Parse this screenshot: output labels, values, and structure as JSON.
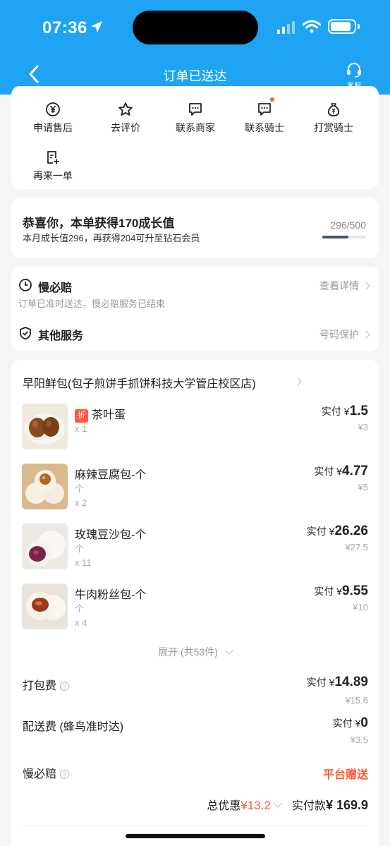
{
  "status_bar": {
    "time": "07:36"
  },
  "nav": {
    "title": "订单已送达",
    "customer_service": "客服"
  },
  "actions": [
    {
      "label": "申请售后",
      "icon": "refund-yen-icon"
    },
    {
      "label": "去评价",
      "icon": "star-icon"
    },
    {
      "label": "联系商家",
      "icon": "chat-icon"
    },
    {
      "label": "联系骑士",
      "icon": "chat-icon",
      "badge": true
    },
    {
      "label": "打赏骑士",
      "icon": "money-bag-icon"
    },
    {
      "label": "再来一单",
      "icon": "add-order-icon"
    }
  ],
  "growth": {
    "title": "恭喜你，本单获得170成长值",
    "subtitle": "本月成长值296，再获得204可升至钻石会员",
    "count": "296/500",
    "progress": 0.592
  },
  "services": {
    "guarantee": {
      "title": "慢必赔",
      "subtitle": "订单已准时送达，慢必赔服务已结束",
      "link": "查看详情"
    },
    "other": {
      "title": "其他服务",
      "link": "号码保护"
    }
  },
  "order": {
    "shop": "早阳鲜包(包子煎饼手抓饼科技大学管庄校区店)",
    "paid_prefix": "实付 ¥",
    "items": [
      {
        "name": "茶叶蛋",
        "tag": "折",
        "unit": "",
        "qty": "x 1",
        "paid": "1.5",
        "original": "¥3"
      },
      {
        "name": "麻辣豆腐包-个",
        "tag": "",
        "unit": "个",
        "qty": "x 2",
        "paid": "4.77",
        "original": "¥5"
      },
      {
        "name": "玫瑰豆沙包-个",
        "tag": "",
        "unit": "个",
        "qty": "x 11",
        "paid": "26.26",
        "original": "¥27.5"
      },
      {
        "name": "牛肉粉丝包-个",
        "tag": "",
        "unit": "个",
        "qty": "x 4",
        "paid": "9.55",
        "original": "¥10"
      }
    ],
    "expand": "展开 (共53件)",
    "packing": {
      "label": "打包费",
      "paid_prefix": "实付 ¥",
      "paid": "14.89",
      "original": "¥15.6"
    },
    "delivery": {
      "label": "配送费 (蜂鸟准时达)",
      "paid_prefix": "实付 ¥",
      "paid": "0",
      "original": "¥3.5"
    },
    "guarantee": {
      "label": "慢必赔",
      "value": "平台赠送"
    },
    "summary": {
      "discount_label": "总优惠",
      "discount": "¥13.2",
      "total_label": "实付款",
      "total": "¥ 169.9"
    }
  },
  "colors": {
    "header": "#1ea4f2",
    "accent": "#ff5a3c"
  }
}
